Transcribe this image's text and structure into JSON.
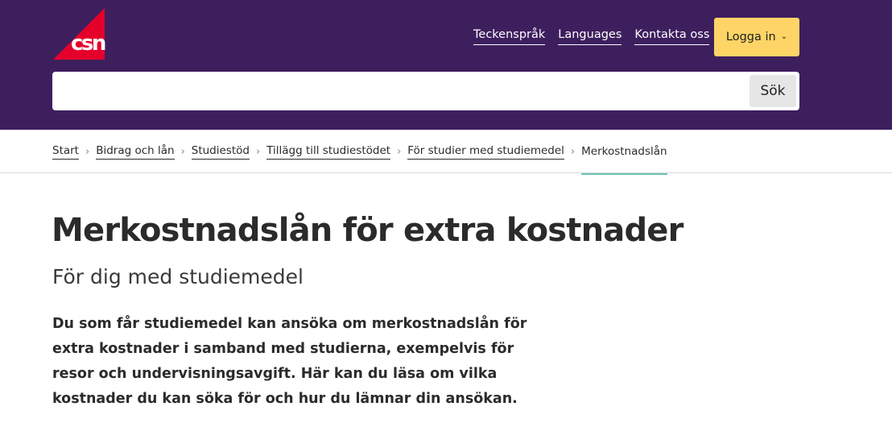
{
  "brand": {
    "logo_text": "csn",
    "color_red": "#e4002b",
    "color_purple": "#3e1f5e",
    "color_yellow": "#ffd466"
  },
  "header": {
    "links": [
      "Teckenspråk",
      "Languages",
      "Kontakta oss"
    ],
    "login_label": "Logga in",
    "search": {
      "placeholder": "",
      "button_label": "Sök"
    }
  },
  "breadcrumb": {
    "items": [
      "Start",
      "Bidrag och lån",
      "Studiestöd",
      "Tillägg till studiestödet",
      "För studier med studiemedel"
    ],
    "current": "Merkostnadslån"
  },
  "main": {
    "title": "Merkostnadslån för extra kostnader",
    "subtitle": "För dig med studiemedel",
    "intro": "Du som får studiemedel kan ansöka om merkostnadslån för extra kostnader i samband med studierna, exempelvis för resor och undervisningsavgift. Här kan du läsa om vilka kostnader du kan söka för och hur du lämnar din ansökan."
  }
}
